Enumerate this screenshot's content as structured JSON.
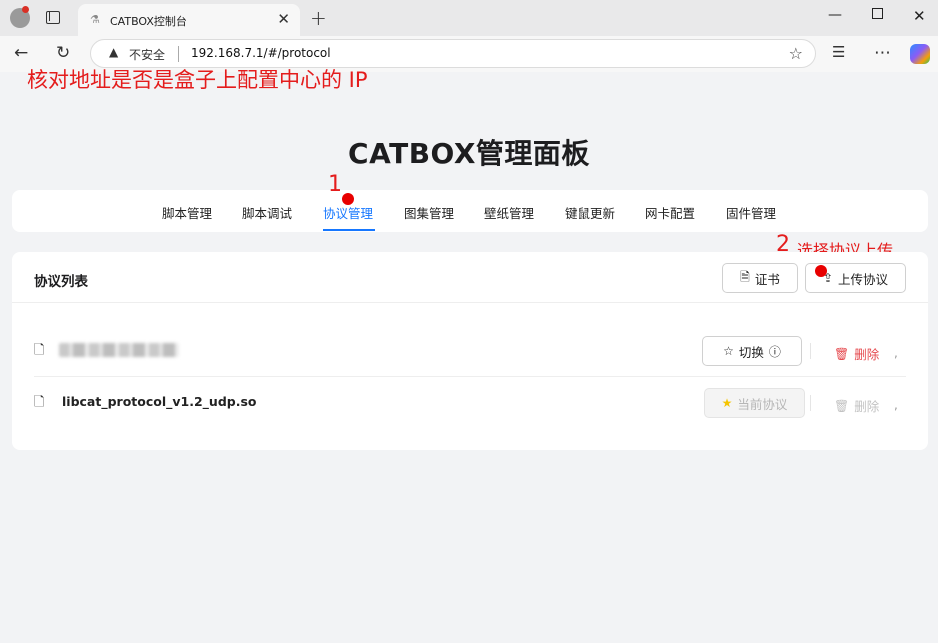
{
  "browser": {
    "tab_title": "CATBOX控制台",
    "url_security": "不安全",
    "url": "192.168.7.1/#/protocol",
    "icons": [
      "profile-icon",
      "tab-actions-icon",
      "close-tab-icon",
      "new-tab-icon",
      "minimize-icon",
      "maximize-icon",
      "close-window-icon",
      "back-icon",
      "reload-icon",
      "warning-icon",
      "favorite-star-icon",
      "favorites-list-icon",
      "more-icon",
      "copilot-icon"
    ]
  },
  "annotations": {
    "top_note": "核对地址是否是盒子上配置中心的 IP",
    "step1": "1",
    "step2": "2",
    "step2_text": "选择协议上传"
  },
  "page": {
    "title": "CATBOX管理面板",
    "nav": [
      "脚本管理",
      "脚本调试",
      "协议管理",
      "图集管理",
      "壁纸管理",
      "键鼠更新",
      "网卡配置",
      "固件管理"
    ],
    "active_nav": "协议管理"
  },
  "protocol_list": {
    "title": "协议列表",
    "cert_button": "证书",
    "upload_button": "上传协议",
    "rows": [
      {
        "name": "",
        "action_label": "切换",
        "action_enabled": true,
        "delete_label": "删除",
        "delete_enabled": true
      },
      {
        "name": "libcat_protocol_v1.2_udp.so",
        "action_label": "当前协议",
        "action_enabled": false,
        "delete_label": "删除",
        "delete_enabled": false
      }
    ],
    "trailing_mark": ","
  },
  "colors": {
    "accent": "#1677ff",
    "danger": "#e5484d",
    "annotation": "#e41c1c",
    "current_star": "#f5c400"
  }
}
